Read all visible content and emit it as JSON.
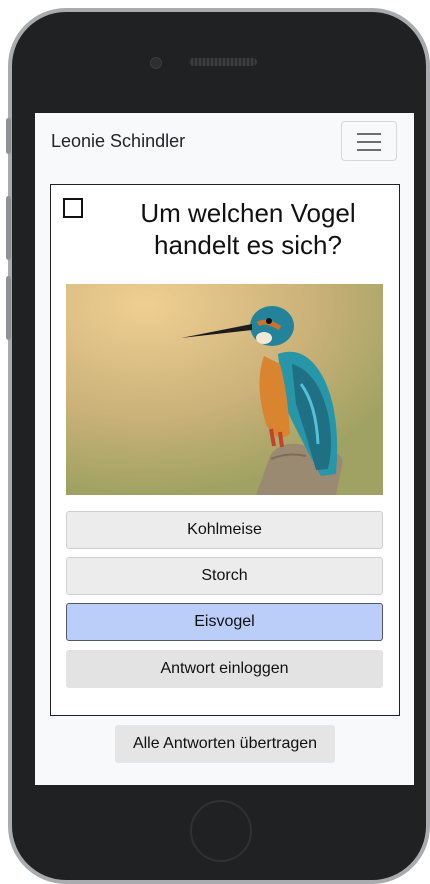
{
  "navbar": {
    "brand": "Leonie Schindler",
    "menu_icon": "hamburger-menu-icon"
  },
  "quiz": {
    "checked": false,
    "question": "Um welchen Vogel handelt es sich?",
    "image_subject": "kingfisher",
    "answers": [
      {
        "label": "Kohlmeise",
        "selected": false
      },
      {
        "label": "Storch",
        "selected": false
      },
      {
        "label": "Eisvogel",
        "selected": true
      }
    ],
    "submit_label": "Antwort einloggen"
  },
  "footer": {
    "transfer_label": "Alle Antworten übertragen"
  },
  "colors": {
    "selected_answer": "#bbcdf9",
    "answer_background": "#ececec",
    "navbar_background": "#f8f9fa"
  }
}
